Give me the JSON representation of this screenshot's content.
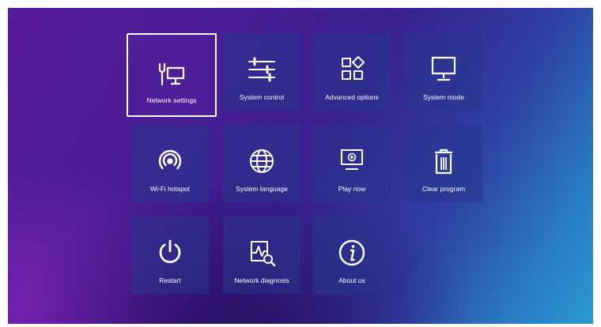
{
  "menu": {
    "items": [
      {
        "label": "Network settings",
        "icon": "network-settings-icon",
        "selected": true
      },
      {
        "label": "System control",
        "icon": "sliders-icon"
      },
      {
        "label": "Advanced options",
        "icon": "apps-grid-icon"
      },
      {
        "label": "System mode",
        "icon": "monitor-icon"
      },
      {
        "label": "Wi-Fi hotspot",
        "icon": "hotspot-icon"
      },
      {
        "label": "System language",
        "icon": "globe-icon"
      },
      {
        "label": "Play now",
        "icon": "play-screen-icon"
      },
      {
        "label": "Clear program",
        "icon": "trash-icon"
      },
      {
        "label": "Restart",
        "icon": "power-icon"
      },
      {
        "label": "Network diagnosis",
        "icon": "diagnosis-icon"
      },
      {
        "label": "About us",
        "icon": "info-icon"
      }
    ]
  },
  "colors": {
    "tile_background": "#28378c",
    "selection_border": "#ffffff",
    "icon_color": "#ffffff"
  }
}
